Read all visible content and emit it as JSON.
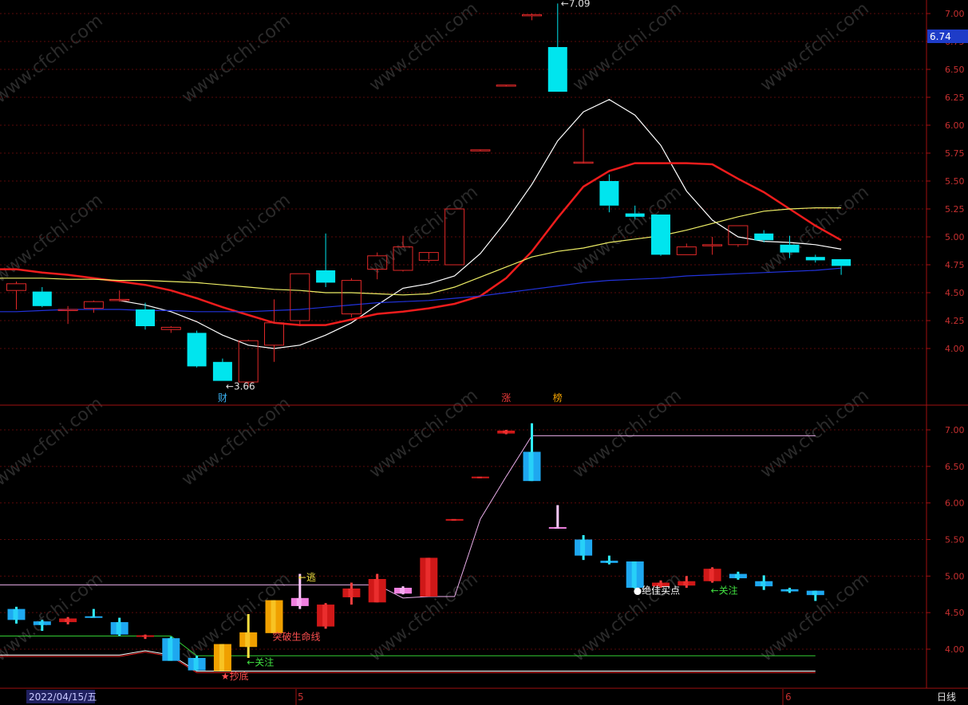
{
  "watermark": "www.cfchi.com",
  "colors": {
    "background": "#000000",
    "panel_border": "#a01010",
    "grid": "#5a0a0a",
    "axis_text": "#c83030",
    "up_candle": "#e02828",
    "down_candle": "#00e5ee",
    "ma_fast": "#ffffff",
    "ma_mid": "#ee1c1c",
    "ma_slow": "#eeee66",
    "ma_long": "#2233dd",
    "price_tag_bg": "#1e3cc8"
  },
  "status_bar": {
    "date_label": "2022/04/15/五",
    "month_marks": [
      "5",
      "6"
    ],
    "period_label": "日线"
  },
  "chart_data": [
    {
      "type": "candlestick",
      "panel": "main",
      "y_ticks": [
        "7.00",
        "6.75",
        "6.50",
        "6.25",
        "6.00",
        "5.75",
        "5.50",
        "5.25",
        "5.00",
        "4.75",
        "4.50",
        "4.25",
        "4.00"
      ],
      "ylim": [
        3.53,
        7.12
      ],
      "current_price_tag": "6.74",
      "candles": [
        {
          "o": 4.52,
          "h": 4.6,
          "l": 4.35,
          "c": 4.58
        },
        {
          "o": 4.51,
          "h": 4.55,
          "l": 4.37,
          "c": 4.38
        },
        {
          "o": 4.35,
          "h": 4.38,
          "l": 4.22,
          "c": 4.35
        },
        {
          "o": 4.36,
          "h": 4.43,
          "l": 4.32,
          "c": 4.42
        },
        {
          "o": 4.44,
          "h": 4.52,
          "l": 4.42,
          "c": 4.44
        },
        {
          "o": 4.35,
          "h": 4.41,
          "l": 4.17,
          "c": 4.2
        },
        {
          "o": 4.17,
          "h": 4.2,
          "l": 4.14,
          "c": 4.19
        },
        {
          "o": 4.14,
          "h": 4.16,
          "l": 3.83,
          "c": 3.84
        },
        {
          "o": 3.88,
          "h": 3.91,
          "l": 3.71,
          "c": 3.71
        },
        {
          "o": 3.7,
          "h": 4.08,
          "l": 3.66,
          "c": 4.07
        },
        {
          "o": 4.03,
          "h": 4.44,
          "l": 3.88,
          "c": 4.23
        },
        {
          "o": 4.25,
          "h": 4.67,
          "l": 4.2,
          "c": 4.67
        },
        {
          "o": 4.7,
          "h": 5.03,
          "l": 4.55,
          "c": 4.59
        },
        {
          "o": 4.31,
          "h": 4.63,
          "l": 4.28,
          "c": 4.61
        },
        {
          "o": 4.71,
          "h": 4.86,
          "l": 4.62,
          "c": 4.83
        },
        {
          "o": 4.7,
          "h": 5.01,
          "l": 4.69,
          "c": 4.91
        },
        {
          "o": 4.79,
          "h": 4.8,
          "l": 4.77,
          "c": 4.86
        },
        {
          "o": 4.75,
          "h": 5.25,
          "l": 4.75,
          "c": 5.25
        },
        {
          "o": 5.78,
          "h": 5.78,
          "l": 5.78,
          "c": 5.78
        },
        {
          "o": 6.36,
          "h": 6.36,
          "l": 6.36,
          "c": 6.36
        },
        {
          "o": 6.99,
          "h": 7.0,
          "l": 6.94,
          "c": 6.99
        },
        {
          "o": 6.7,
          "h": 7.09,
          "l": 6.3,
          "c": 6.3
        },
        {
          "o": 5.67,
          "h": 5.97,
          "l": 5.67,
          "c": 5.67
        },
        {
          "o": 5.5,
          "h": 5.56,
          "l": 5.22,
          "c": 5.28
        },
        {
          "o": 5.21,
          "h": 5.28,
          "l": 5.16,
          "c": 5.18
        },
        {
          "o": 5.2,
          "h": 5.2,
          "l": 4.83,
          "c": 4.84
        },
        {
          "o": 4.84,
          "h": 4.94,
          "l": 4.84,
          "c": 4.91
        },
        {
          "o": 4.93,
          "h": 5.0,
          "l": 4.84,
          "c": 4.93
        },
        {
          "o": 4.93,
          "h": 5.1,
          "l": 4.91,
          "c": 5.1
        },
        {
          "o": 5.03,
          "h": 5.06,
          "l": 4.95,
          "c": 4.97
        },
        {
          "o": 4.93,
          "h": 5.01,
          "l": 4.81,
          "c": 4.86
        },
        {
          "o": 4.82,
          "h": 4.84,
          "l": 4.77,
          "c": 4.79
        },
        {
          "o": 4.8,
          "h": 4.8,
          "l": 4.66,
          "c": 4.74
        }
      ],
      "moving_averages": [
        {
          "color_key": "ma_fast",
          "values": [
            null,
            null,
            null,
            null,
            4.43,
            4.39,
            4.33,
            4.24,
            4.12,
            4.03,
            4.0,
            4.03,
            4.12,
            4.23,
            4.39,
            4.54,
            4.58,
            4.65,
            4.85,
            5.14,
            5.47,
            5.86,
            6.12,
            6.23,
            6.09,
            5.82,
            5.41,
            5.15,
            5.0,
            4.96,
            4.95,
            4.93,
            4.89
          ]
        },
        {
          "color_key": "ma_mid",
          "values": [
            4.71,
            4.68,
            4.66,
            4.63,
            4.6,
            4.57,
            4.52,
            4.45,
            4.37,
            4.3,
            4.23,
            4.21,
            4.21,
            4.26,
            4.31,
            4.33,
            4.36,
            4.4,
            4.47,
            4.63,
            4.87,
            5.17,
            5.45,
            5.59,
            5.66,
            5.66,
            5.66,
            5.65,
            5.52,
            5.4,
            5.25,
            5.1,
            4.97
          ]
        },
        {
          "color_key": "ma_slow",
          "values": [
            4.63,
            4.63,
            4.62,
            4.62,
            4.61,
            4.61,
            4.6,
            4.59,
            4.57,
            4.55,
            4.53,
            4.52,
            4.5,
            4.5,
            4.49,
            4.48,
            4.49,
            4.55,
            4.64,
            4.73,
            4.82,
            4.87,
            4.9,
            4.95,
            4.98,
            5.01,
            5.06,
            5.12,
            5.18,
            5.23,
            5.25,
            5.26,
            5.26
          ]
        },
        {
          "color_key": "ma_long",
          "values": [
            4.33,
            4.34,
            4.35,
            4.35,
            4.35,
            4.34,
            4.34,
            4.33,
            4.33,
            4.33,
            4.34,
            4.35,
            4.37,
            4.39,
            4.41,
            4.42,
            4.43,
            4.45,
            4.47,
            4.5,
            4.53,
            4.56,
            4.59,
            4.61,
            4.62,
            4.63,
            4.65,
            4.66,
            4.67,
            4.68,
            4.69,
            4.7,
            4.72
          ]
        }
      ],
      "annotations": [
        {
          "text": "7.09",
          "bar": 21,
          "price": 7.09
        },
        {
          "text": "3.66",
          "bar": 8,
          "price": 3.66
        }
      ],
      "event_markers": [
        {
          "text": "财",
          "bar": 8,
          "color": "#3ab0f0"
        },
        {
          "text": "涨",
          "bar": 19,
          "color": "#ee3a3a"
        },
        {
          "text": "榜",
          "bar": 21,
          "color": "#f0a000"
        }
      ]
    },
    {
      "type": "candlestick",
      "panel": "indicator",
      "y_ticks": [
        "7.00",
        "6.50",
        "6.00",
        "5.50",
        "5.00",
        "4.50",
        "4.00"
      ],
      "ylim": [
        3.63,
        7.25
      ],
      "candles": [
        {
          "o": 4.55,
          "h": 4.58,
          "l": 4.35,
          "c": 4.4,
          "style": "cyan"
        },
        {
          "o": 4.38,
          "h": 4.4,
          "l": 4.25,
          "c": 4.33,
          "style": "cyan"
        },
        {
          "o": 4.37,
          "h": 4.44,
          "l": 4.34,
          "c": 4.42,
          "style": "red"
        },
        {
          "o": 4.45,
          "h": 4.55,
          "l": 4.44,
          "c": 4.45,
          "style": "cyan"
        },
        {
          "o": 4.37,
          "h": 4.43,
          "l": 4.18,
          "c": 4.2,
          "style": "cyan"
        },
        {
          "o": 4.17,
          "h": 4.2,
          "l": 4.14,
          "c": 4.19,
          "style": "red"
        },
        {
          "o": 4.15,
          "h": 4.17,
          "l": 3.85,
          "c": 3.84,
          "style": "cyan"
        },
        {
          "o": 3.88,
          "h": 3.91,
          "l": 3.71,
          "c": 3.71,
          "style": "cyan"
        },
        {
          "o": 3.7,
          "h": 4.07,
          "l": 3.7,
          "c": 4.07,
          "style": "orange"
        },
        {
          "o": 4.03,
          "h": 4.48,
          "l": 3.88,
          "c": 4.23,
          "style": "orange"
        },
        {
          "o": 4.22,
          "h": 4.67,
          "l": 4.22,
          "c": 4.67,
          "style": "orange"
        },
        {
          "o": 4.7,
          "h": 5.03,
          "l": 4.55,
          "c": 4.59,
          "style": "pink"
        },
        {
          "o": 4.31,
          "h": 4.63,
          "l": 4.28,
          "c": 4.61,
          "style": "red"
        },
        {
          "o": 4.71,
          "h": 4.91,
          "l": 4.61,
          "c": 4.83,
          "style": "red"
        },
        {
          "o": 4.64,
          "h": 5.03,
          "l": 4.64,
          "c": 4.96,
          "style": "red"
        },
        {
          "o": 4.76,
          "h": 4.86,
          "l": 4.75,
          "c": 4.84,
          "style": "pink"
        },
        {
          "o": 4.72,
          "h": 5.25,
          "l": 4.72,
          "c": 5.25,
          "style": "red"
        },
        {
          "o": 5.78,
          "h": 5.78,
          "l": 5.78,
          "c": 5.78,
          "style": "red"
        },
        {
          "o": 6.36,
          "h": 6.36,
          "l": 6.36,
          "c": 6.36,
          "style": "red"
        },
        {
          "o": 6.99,
          "h": 7.0,
          "l": 6.94,
          "c": 6.95,
          "style": "red"
        },
        {
          "o": 6.7,
          "h": 7.09,
          "l": 6.3,
          "c": 6.3,
          "style": "cyan"
        },
        {
          "o": 5.67,
          "h": 5.97,
          "l": 5.67,
          "c": 5.67,
          "style": "pink"
        },
        {
          "o": 5.5,
          "h": 5.56,
          "l": 5.22,
          "c": 5.28,
          "style": "cyan"
        },
        {
          "o": 5.21,
          "h": 5.28,
          "l": 5.16,
          "c": 5.18,
          "style": "cyan"
        },
        {
          "o": 5.2,
          "h": 5.2,
          "l": 4.83,
          "c": 4.84,
          "style": "cyan"
        },
        {
          "o": 4.86,
          "h": 4.94,
          "l": 4.84,
          "c": 4.91,
          "style": "red"
        },
        {
          "o": 4.87,
          "h": 5.0,
          "l": 4.84,
          "c": 4.93,
          "style": "red"
        },
        {
          "o": 4.93,
          "h": 5.12,
          "l": 4.91,
          "c": 5.1,
          "style": "red"
        },
        {
          "o": 5.03,
          "h": 5.06,
          "l": 4.95,
          "c": 4.97,
          "style": "cyan"
        },
        {
          "o": 4.93,
          "h": 5.01,
          "l": 4.81,
          "c": 4.86,
          "style": "cyan"
        },
        {
          "o": 4.82,
          "h": 4.84,
          "l": 4.77,
          "c": 4.79,
          "style": "cyan"
        },
        {
          "o": 4.8,
          "h": 4.8,
          "l": 4.66,
          "c": 4.74,
          "style": "cyan"
        }
      ],
      "lines": [
        {
          "color": "#eaaeea",
          "values": [
            4.88,
            4.88,
            4.88,
            4.88,
            4.88,
            4.88,
            4.88,
            4.88,
            4.88,
            4.88,
            4.88,
            4.88,
            4.88,
            4.88,
            4.88,
            4.7,
            4.72,
            4.72,
            5.78,
            6.36,
            6.92,
            6.92,
            6.92,
            6.92,
            6.92,
            6.92,
            6.92,
            6.92,
            6.92,
            6.92,
            6.92,
            6.92
          ]
        },
        {
          "color": "#33cc33",
          "values": [
            4.18,
            4.18,
            4.18,
            4.18,
            4.18,
            4.18,
            4.18,
            3.91,
            3.91,
            3.91,
            3.91,
            3.91,
            3.91,
            3.91,
            3.91,
            3.91,
            3.91,
            3.91,
            3.91,
            3.91,
            3.91,
            3.91,
            3.91,
            3.91,
            3.91,
            3.91,
            3.91,
            3.91,
            3.91,
            3.91,
            3.91,
            3.91
          ]
        },
        {
          "color": "#ffffff",
          "values": [
            3.92,
            3.92,
            3.92,
            3.92,
            3.92,
            3.98,
            3.92,
            3.7,
            3.7,
            3.7,
            3.7,
            3.7,
            3.7,
            3.7,
            3.7,
            3.7,
            3.7,
            3.7,
            3.7,
            3.7,
            3.7,
            3.7,
            3.7,
            3.7,
            3.7,
            3.7,
            3.7,
            3.7,
            3.7,
            3.7,
            3.7,
            3.7
          ]
        },
        {
          "color": "#ee2222",
          "values": [
            3.9,
            3.9,
            3.9,
            3.9,
            3.9,
            3.96,
            3.9,
            3.68,
            3.68,
            3.68,
            3.68,
            3.68,
            3.68,
            3.68,
            3.68,
            3.68,
            3.68,
            3.68,
            3.68,
            3.68,
            3.68,
            3.68,
            3.68,
            3.68,
            3.68,
            3.68,
            3.68,
            3.68,
            3.68,
            3.68,
            3.68,
            3.68
          ]
        }
      ],
      "signals": [
        {
          "text": "←逃",
          "bar": 11,
          "price": 4.98,
          "color": "#f0e040"
        },
        {
          "text": "突破生命线",
          "bar": 10,
          "price": 4.17,
          "color": "#ff5050"
        },
        {
          "text": "←关注",
          "bar": 9,
          "price": 3.82,
          "color": "#40e040"
        },
        {
          "text": "★抄底",
          "bar": 8,
          "price": 3.63,
          "color": "#ff5050"
        },
        {
          "text": "●绝佳买点",
          "bar": 24,
          "price": 4.8,
          "color": "#ffffff"
        },
        {
          "text": "←关注",
          "bar": 27,
          "price": 4.8,
          "color": "#40e040"
        }
      ]
    }
  ]
}
